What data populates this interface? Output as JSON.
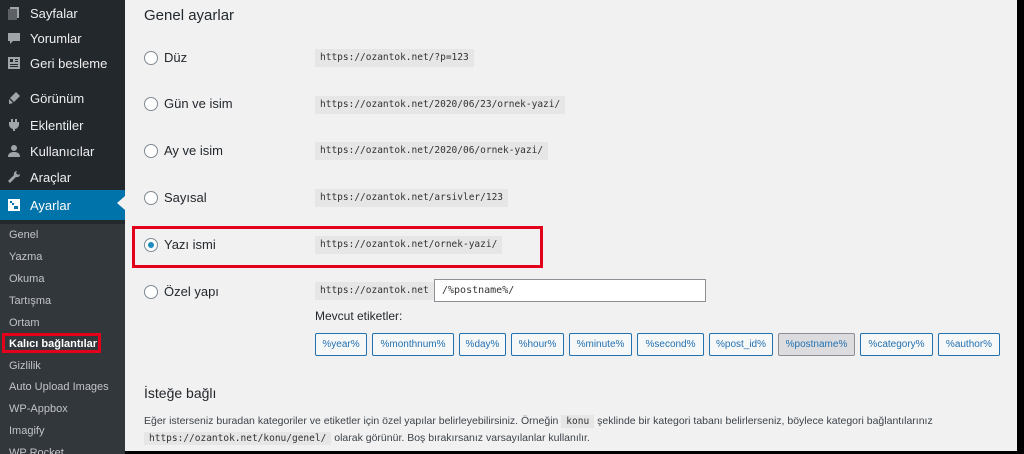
{
  "sidebar": {
    "menu": [
      {
        "label": "Sayfalar",
        "icon": "pages-icon"
      },
      {
        "label": "Yorumlar",
        "icon": "comments-icon"
      },
      {
        "label": "Geri besleme",
        "icon": "feedback-icon"
      },
      {
        "label": "Görünüm",
        "icon": "appearance-icon"
      },
      {
        "label": "Eklentiler",
        "icon": "plugins-icon"
      },
      {
        "label": "Kullanıcılar",
        "icon": "users-icon"
      },
      {
        "label": "Araçlar",
        "icon": "tools-icon"
      },
      {
        "label": "Ayarlar",
        "icon": "settings-icon"
      }
    ],
    "submenu": [
      "Genel",
      "Yazma",
      "Okuma",
      "Tartışma",
      "Ortam",
      "Kalıcı bağlantılar",
      "Gizlilik",
      "Auto Upload Images",
      "WP-Appbox",
      "Imagify",
      "WP Rocket"
    ]
  },
  "main": {
    "general_title": "Genel ayarlar",
    "options": [
      {
        "label": "Düz",
        "example": "https://ozantok.net/?p=123"
      },
      {
        "label": "Gün ve isim",
        "example": "https://ozantok.net/2020/06/23/ornek-yazi/"
      },
      {
        "label": "Ay ve isim",
        "example": "https://ozantok.net/2020/06/ornek-yazi/"
      },
      {
        "label": "Sayısal",
        "example": "https://ozantok.net/arsivler/123"
      },
      {
        "label": "Yazı ismi",
        "example": "https://ozantok.net/ornek-yazi/"
      },
      {
        "label": "Özel yapı",
        "example": "https://ozantok.net"
      }
    ],
    "selected_option": "Yazı ismi",
    "custom_structure_value": "/%postname%/",
    "tags_label": "Mevcut etiketler:",
    "tags": [
      "%year%",
      "%monthnum%",
      "%day%",
      "%hour%",
      "%minute%",
      "%second%",
      "%post_id%",
      "%postname%",
      "%category%",
      "%author%"
    ],
    "active_tag": "%postname%",
    "optional_title": "İsteğe bağlı",
    "desc1_part1": "Eğer isterseniz buradan kategoriler ve etiketler için özel yapılar belirleyebilirsiniz. Örneğin",
    "desc1_code": "konu",
    "desc1_part2": "şeklinde bir kategori tabanı belirlerseniz, böylece kategori bağlantılarınız",
    "desc2_code": "https://ozantok.net/konu/genel/",
    "desc2_part": "olarak görünür. Boş bırakırsanız varsayılanlar kullanılır."
  },
  "colors": {
    "sidebar_bg": "#23282d",
    "active_bg": "#0073aa",
    "highlight_red": "#e2001a",
    "link_blue": "#2271b1"
  }
}
